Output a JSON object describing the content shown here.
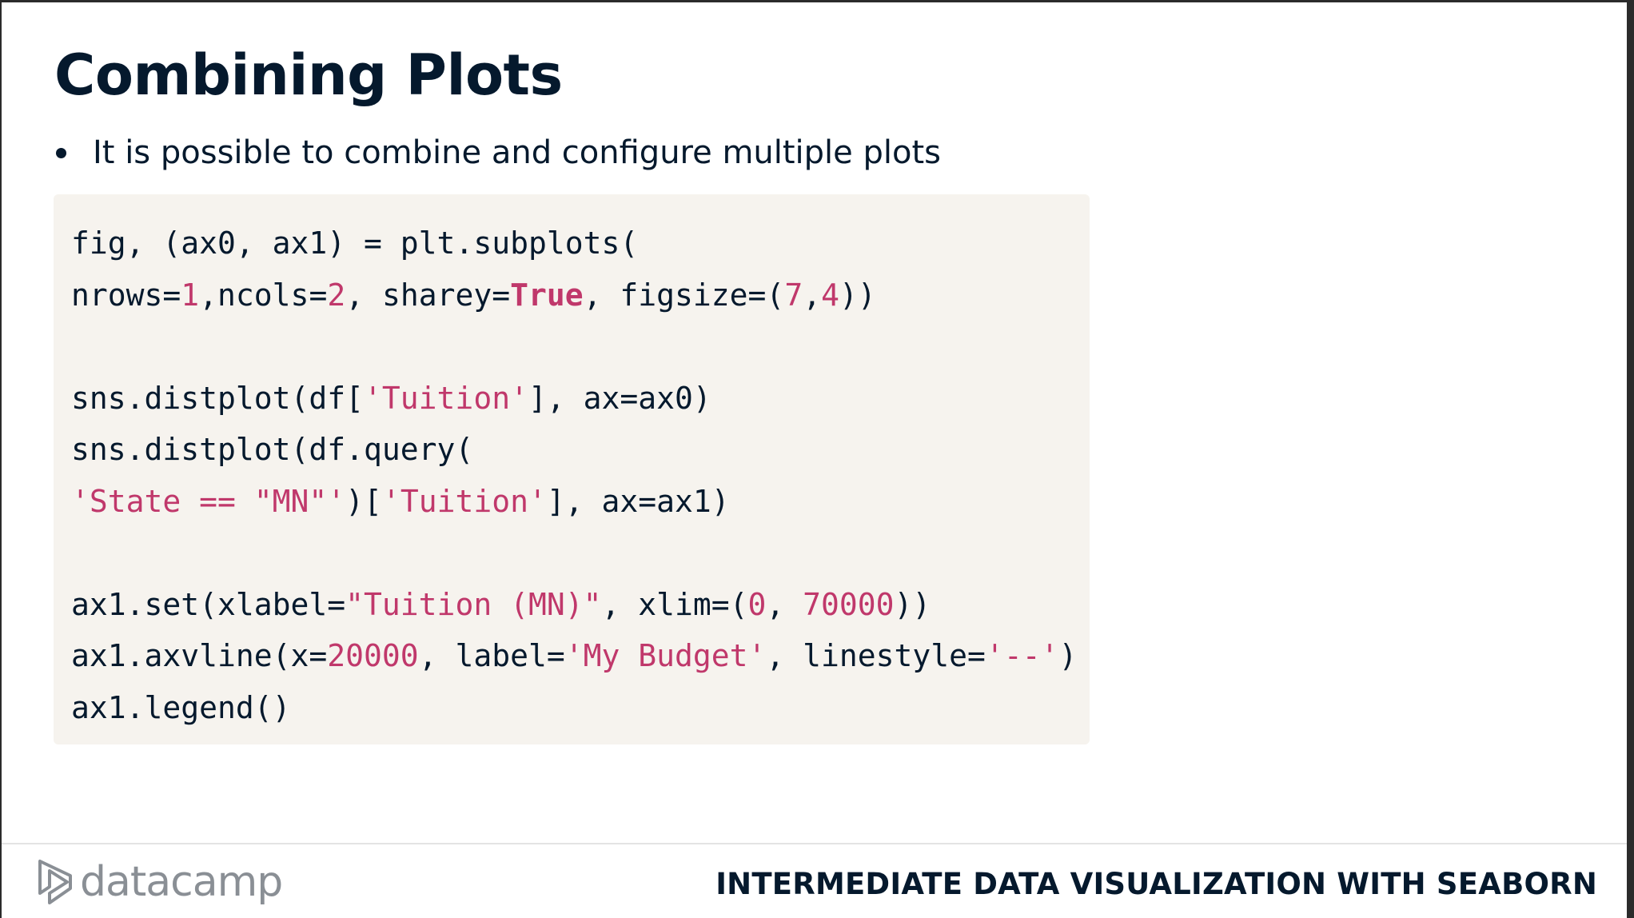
{
  "slide": {
    "title": "Combining Plots",
    "bullets": [
      "It is possible to combine and configure multiple plots"
    ]
  },
  "code_block": {
    "lines": [
      [
        {
          "type": "plain",
          "text": "fig, (ax0, ax1) = plt.subplots("
        }
      ],
      [
        {
          "type": "plain",
          "text": "nrows="
        },
        {
          "type": "num",
          "text": "1"
        },
        {
          "type": "plain",
          "text": ",ncols="
        },
        {
          "type": "num",
          "text": "2"
        },
        {
          "type": "plain",
          "text": ", sharey="
        },
        {
          "type": "kw",
          "text": "True"
        },
        {
          "type": "plain",
          "text": ", figsize=("
        },
        {
          "type": "num",
          "text": "7"
        },
        {
          "type": "plain",
          "text": ","
        },
        {
          "type": "num",
          "text": "4"
        },
        {
          "type": "plain",
          "text": "))"
        }
      ],
      [],
      [
        {
          "type": "plain",
          "text": "sns.distplot(df["
        },
        {
          "type": "str",
          "text": "'Tuition'"
        },
        {
          "type": "plain",
          "text": "], ax=ax0)"
        }
      ],
      [
        {
          "type": "plain",
          "text": "sns.distplot(df.query("
        }
      ],
      [
        {
          "type": "str",
          "text": "'State == \"MN\"'"
        },
        {
          "type": "plain",
          "text": ")["
        },
        {
          "type": "str",
          "text": "'Tuition'"
        },
        {
          "type": "plain",
          "text": "], ax=ax1)"
        }
      ],
      [],
      [
        {
          "type": "plain",
          "text": "ax1.set(xlabel="
        },
        {
          "type": "str",
          "text": "\"Tuition (MN)\""
        },
        {
          "type": "plain",
          "text": ", xlim=("
        },
        {
          "type": "num",
          "text": "0"
        },
        {
          "type": "plain",
          "text": ", "
        },
        {
          "type": "num",
          "text": "70000"
        },
        {
          "type": "plain",
          "text": "))"
        }
      ],
      [
        {
          "type": "plain",
          "text": "ax1.axvline(x="
        },
        {
          "type": "num",
          "text": "20000"
        },
        {
          "type": "plain",
          "text": ", label="
        },
        {
          "type": "str",
          "text": "'My Budget'"
        },
        {
          "type": "plain",
          "text": ", linestyle="
        },
        {
          "type": "str",
          "text": "'--'"
        },
        {
          "type": "plain",
          "text": ")"
        }
      ],
      [
        {
          "type": "plain",
          "text": "ax1.legend()"
        }
      ]
    ]
  },
  "footer": {
    "logo_text": "datacamp",
    "logo_icon": "datacamp-logo-icon",
    "course_title": "INTERMEDIATE DATA VISUALIZATION WITH SEABORN"
  },
  "colors": {
    "text": "#05192d",
    "code_highlight": "#c0386b",
    "code_background": "#f6f3ee",
    "logo": "#8a8f95"
  }
}
